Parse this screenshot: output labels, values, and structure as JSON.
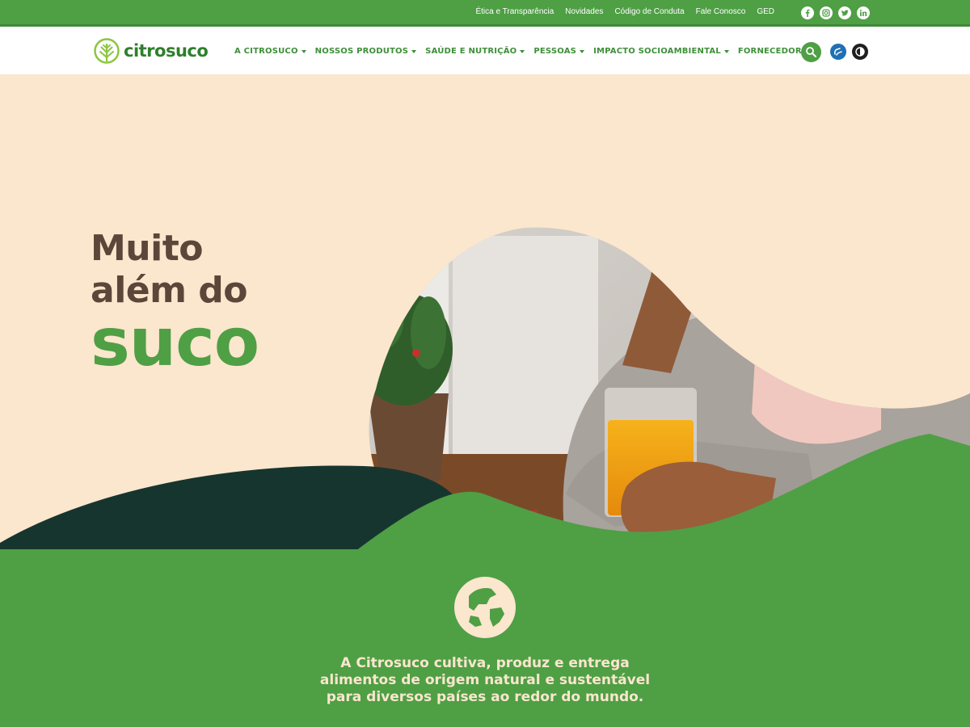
{
  "topbar": {
    "links": [
      "Ética e Transparência",
      "Novidades",
      "Código de Conduta",
      "Fale Conosco",
      "GED"
    ],
    "social_icons": [
      "facebook-icon",
      "instagram-icon",
      "twitter-icon",
      "linkedin-icon"
    ]
  },
  "navbar": {
    "logo_text": "citrosuco",
    "menu": [
      "A CITROSUCO",
      "NOSSOS PRODUTOS",
      "SAÚDE E NUTRIÇÃO",
      "PESSOAS",
      "IMPACTO SOCIOAMBIENTAL",
      "FORNECEDORES"
    ],
    "tools": [
      "search-icon",
      "libras-hands-icon",
      "contrast-icon"
    ]
  },
  "hero": {
    "line1": "Muito",
    "line2": "além do",
    "line3": "suco"
  },
  "mission": {
    "icon": "globe-icon",
    "lines": [
      "A Citrosuco cultiva, produz e entrega",
      "alimentos de origem natural e sustentável",
      "para diversos países ao redor do mundo."
    ]
  },
  "colors": {
    "brand_green": "#4f9f45",
    "cream": "#fbe6ce",
    "dark_green": "#17352f",
    "headline_brown": "#5b4639"
  }
}
